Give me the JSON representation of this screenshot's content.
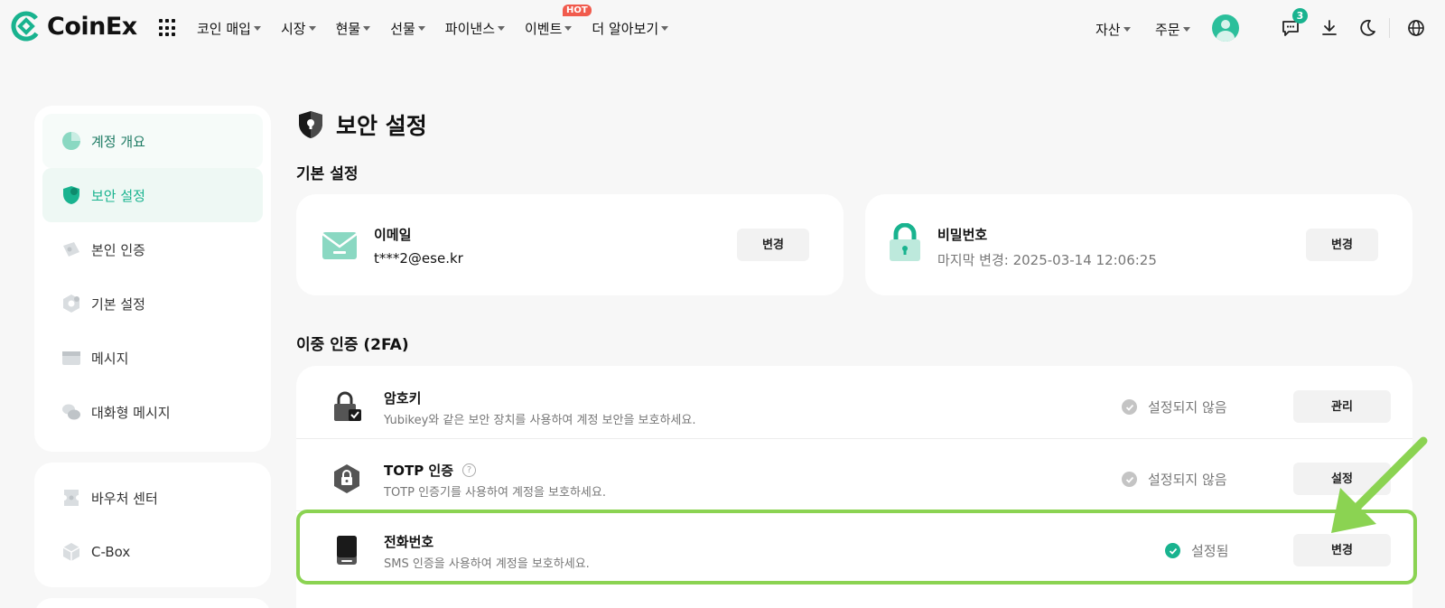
{
  "brand": {
    "name": "CoinEx"
  },
  "nav": {
    "items": [
      {
        "label": "코인 매입"
      },
      {
        "label": "시장"
      },
      {
        "label": "현물"
      },
      {
        "label": "선물"
      },
      {
        "label": "파이낸스"
      },
      {
        "label": "이벤트",
        "badge": "HOT"
      },
      {
        "label": "더 알아보기"
      }
    ],
    "right": {
      "assets": "자산",
      "orders": "주문",
      "message_count": "3"
    }
  },
  "sidebar": {
    "group1": [
      {
        "label": "계정 개요"
      },
      {
        "label": "보안 설정"
      },
      {
        "label": "본인 인증"
      },
      {
        "label": "기본 설정"
      },
      {
        "label": "메시지"
      },
      {
        "label": "대화형 메시지"
      }
    ],
    "group2": [
      {
        "label": "바우처 센터"
      },
      {
        "label": "C-Box"
      }
    ]
  },
  "page": {
    "title": "보안 설정",
    "basic_title": "기본 설정",
    "twofa_title": "이중 인증 (2FA)"
  },
  "email": {
    "title": "이메일",
    "value": "t***2@ese.kr",
    "button": "변경"
  },
  "password": {
    "title": "비밀번호",
    "last_changed": "마지막 변경: 2025-03-14 12:06:25",
    "button": "변경"
  },
  "twofa": [
    {
      "title": "암호키",
      "desc": "Yubikey와 같은 보안 장치를 사용하여 계정 보안을 보호하세요.",
      "status": "설정되지 않음",
      "button": "관리"
    },
    {
      "title": "TOTP 인증",
      "help": "?",
      "desc": "TOTP 인증기를 사용하여 계정을 보호하세요.",
      "status": "설정되지 않음",
      "button": "설정"
    },
    {
      "title": "전화번호",
      "desc": "SMS 인증을 사용하여 계정을 보호하세요.",
      "status": "설정됨",
      "button": "변경"
    }
  ],
  "colors": {
    "accent": "#19b38f",
    "highlight": "#8bd352",
    "hot": "#f15b4d"
  }
}
